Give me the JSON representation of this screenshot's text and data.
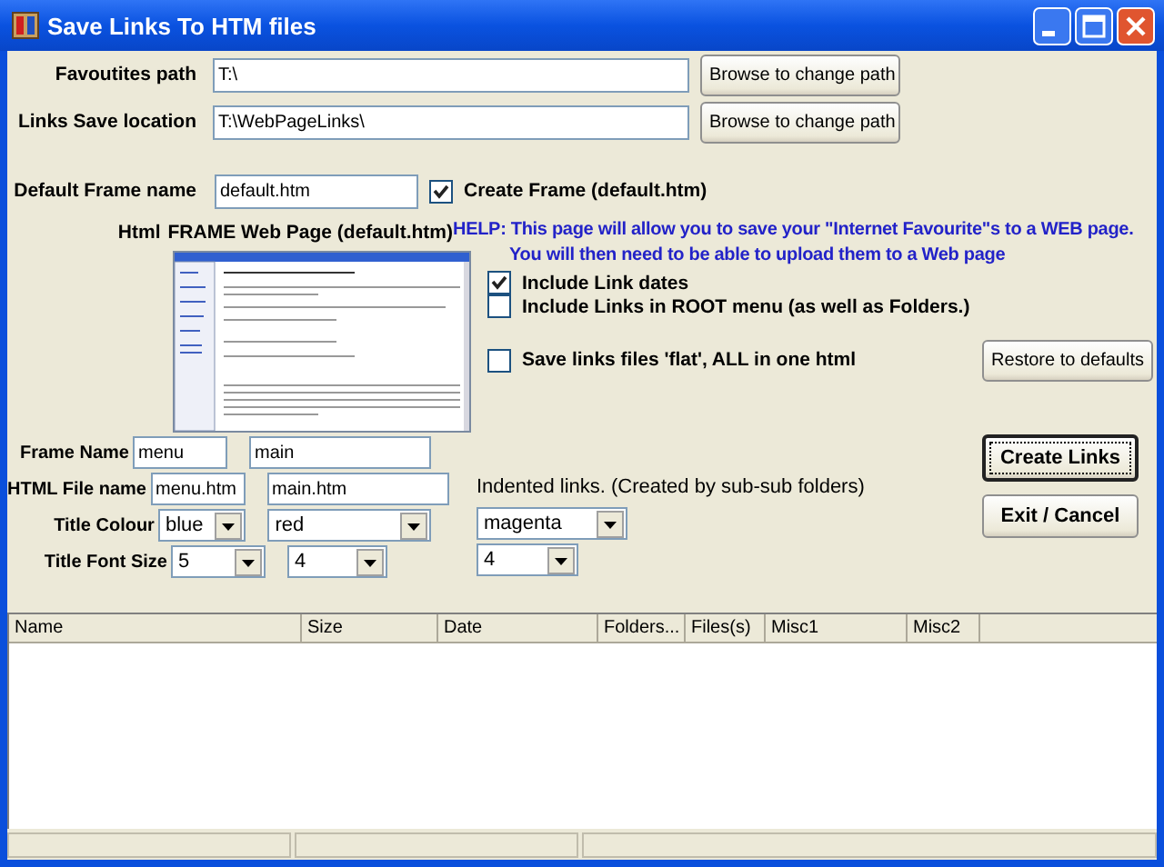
{
  "window": {
    "title": "Save Links To HTM files"
  },
  "paths": [
    {
      "label": "Favoutites path",
      "value": "T:\\",
      "button": "Browse to change path"
    },
    {
      "label": "Links Save location",
      "value": "T:\\WebPageLinks\\",
      "button": "Browse to change path"
    }
  ],
  "default_frame": {
    "label": "Default Frame name",
    "value": "default.htm",
    "checkbox": {
      "label": "Create Frame (default.htm)",
      "checked": true
    }
  },
  "html_frame": {
    "label": "Html",
    "caption": "FRAME Web Page (default.htm)"
  },
  "help": [
    "HELP: This page will allow you to save your  \"Internet Favourite\"s to a WEB page.",
    "You will then need to be able to upload them to a Web page"
  ],
  "options": [
    {
      "label": "Include Link dates",
      "checked": true
    },
    {
      "label": "Include Links in ROOT menu (as well as Folders.)",
      "checked": false
    }
  ],
  "flat_option": {
    "label": "Save links files 'flat', ALL in one html",
    "checked": false
  },
  "restore_button": "Restore to defaults",
  "frame_rows": [
    {
      "label": "Frame Name",
      "kind": "text",
      "values": [
        "menu",
        "main"
      ]
    },
    {
      "label": "HTML File name",
      "kind": "text",
      "values": [
        "menu.htm",
        "main.htm"
      ]
    },
    {
      "label": "Title Colour",
      "kind": "dropdown",
      "values": [
        "blue",
        "red",
        "magenta"
      ]
    },
    {
      "label": "Title Font Size",
      "kind": "dropdown",
      "values": [
        "5",
        "4",
        "4"
      ]
    }
  ],
  "indented_note": "Indented links. (Created by sub-sub folders)",
  "buttons": [
    {
      "label": "Create Links",
      "focused": true
    },
    {
      "label": "Exit / Cancel",
      "focused": false
    }
  ],
  "table": {
    "columns": [
      "Name",
      "Size",
      "Date",
      "Folders...",
      "Files(s)",
      "Misc1",
      "Misc2"
    ]
  }
}
